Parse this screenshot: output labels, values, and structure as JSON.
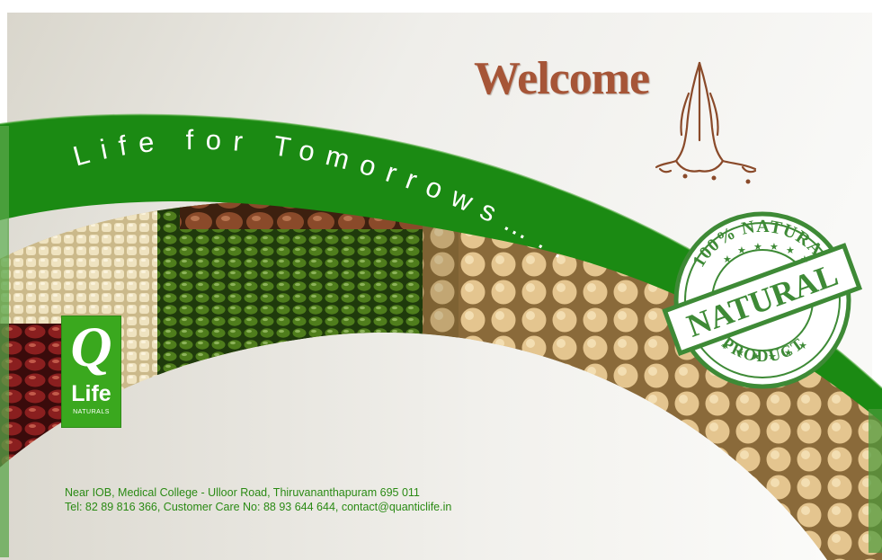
{
  "header": {
    "welcome_text": "Welcome",
    "tagline": "Life for Tomorrows….."
  },
  "stamp": {
    "top_text": "100% NATURAL",
    "center_text": "NATURAL",
    "bottom_text": "PRODUCT"
  },
  "logo": {
    "letter": "Q",
    "word": "Life",
    "sub": "NATURALS"
  },
  "footer": {
    "address_line": "Near IOB, Medical College - Ulloor Road, Thiruvananthapuram 695 011",
    "contact_line": "Tel: 82 89 816 366, Customer Care No: 88 93 644 644, contact@quanticlife.in"
  },
  "colors": {
    "band_green": "#1b8a13",
    "welcome_brown": "#a65537",
    "stamp_green": "#3e8a36",
    "logo_green": "#3aa81e",
    "address_green": "#2a8a14"
  },
  "icons": {
    "namaste": "namaste-hands-icon",
    "stamp": "natural-stamp-icon"
  }
}
